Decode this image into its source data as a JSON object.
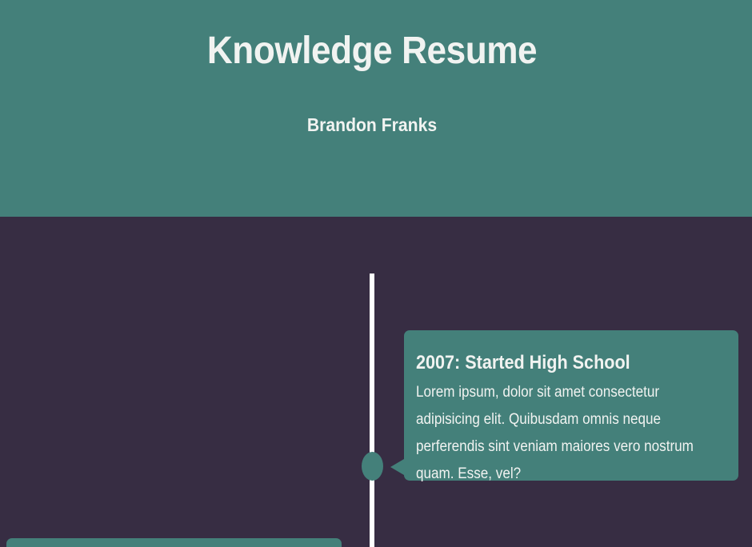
{
  "header": {
    "title": "Knowledge Resume",
    "subtitle": "Brandon Franks"
  },
  "timeline": {
    "entries": [
      {
        "side": "right",
        "title": "2007: Started High School",
        "body": "Lorem ipsum, dolor sit amet consectetur adipisicing elit. Quibusdam omnis neque perferendis sint veniam maiores vero nostrum quam. Esse, vel?"
      },
      {
        "side": "left",
        "title": "",
        "body": ""
      }
    ]
  },
  "colors": {
    "header_bg": "#44807a",
    "page_bg": "#372d43",
    "card_bg": "#44807a",
    "line": "#ffffff",
    "text": "#f1f3f1"
  }
}
